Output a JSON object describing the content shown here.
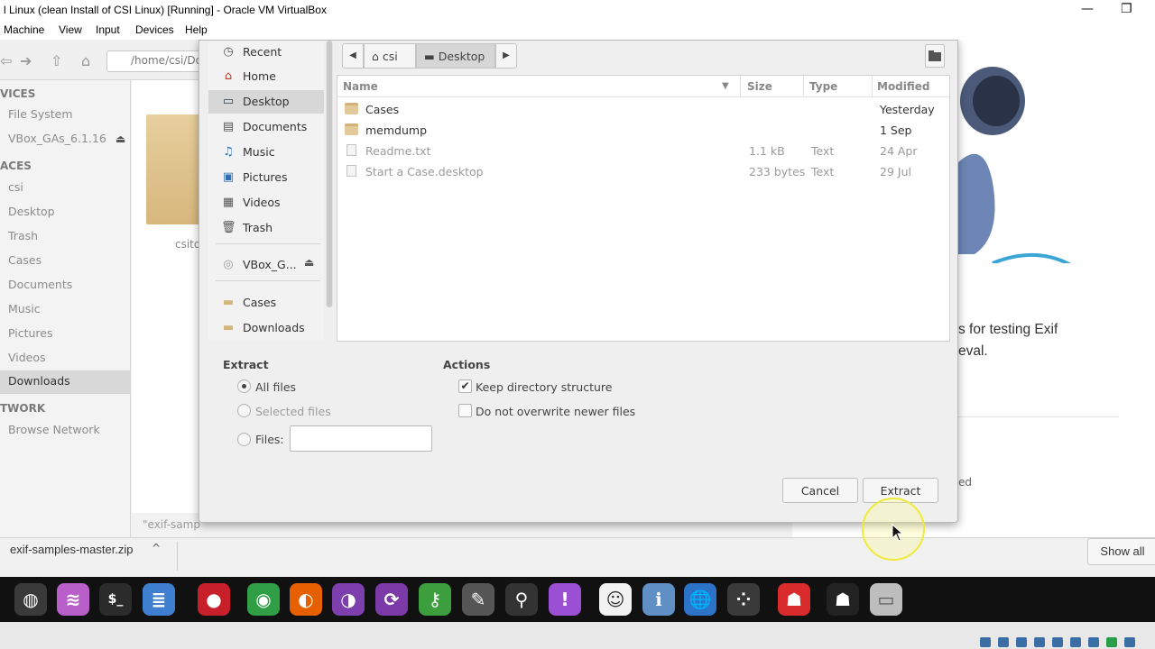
{
  "host": {
    "title": "l Linux (clean Install of CSI Linux) [Running] - Oracle VM VirtualBox",
    "menu": [
      "Machine",
      "View",
      "Input",
      "Devices",
      "Help"
    ],
    "window_controls": {
      "minimize": "—",
      "restore": "❐"
    }
  },
  "file_manager": {
    "path": "/home/csi/Do",
    "sidebar": {
      "devices_heading": "VICES",
      "devices": [
        "File System",
        "VBox_GAs_6.1.16"
      ],
      "places_heading": "ACES",
      "places": [
        "csi",
        "Desktop",
        "Trash",
        "Cases",
        "Documents",
        "Music",
        "Pictures",
        "Videos",
        "Downloads"
      ],
      "selected": "Downloads",
      "network_heading": "TWORK",
      "network": [
        "Browse Network"
      ]
    },
    "item_label": "csito",
    "status": "\"exif-samp"
  },
  "browser_bg": {
    "text_line1": "s for testing Exif",
    "text_line2": "eval.",
    "ed": "ed"
  },
  "downloads_bar": {
    "file": "exif-samples-master.zip",
    "chevron": "^",
    "show_all": "Show all"
  },
  "dialog": {
    "places": [
      {
        "label": "Recent",
        "icon": "clock-icon",
        "glyph": "◷"
      },
      {
        "label": "Home",
        "icon": "home-icon",
        "glyph": "⌂"
      },
      {
        "label": "Desktop",
        "icon": "desktop-icon",
        "glyph": "▭"
      },
      {
        "label": "Documents",
        "icon": "documents-icon",
        "glyph": "▤"
      },
      {
        "label": "Music",
        "icon": "music-icon",
        "glyph": "♫"
      },
      {
        "label": "Pictures",
        "icon": "pictures-icon",
        "glyph": "▣"
      },
      {
        "label": "Videos",
        "icon": "videos-icon",
        "glyph": "▦"
      },
      {
        "label": "Trash",
        "icon": "trash-icon",
        "glyph": "🗑"
      },
      {
        "label": "VBox_G...",
        "icon": "disc-icon",
        "glyph": "◎"
      },
      {
        "label": "Cases",
        "icon": "folder-icon",
        "glyph": "▬"
      },
      {
        "label": "Downloads",
        "icon": "folder-icon",
        "glyph": "▬"
      }
    ],
    "selected_place": "Desktop",
    "pathbar": {
      "back": "◀",
      "home_label": "csi",
      "current": "Desktop",
      "forward": "▶"
    },
    "columns": {
      "name": "Name",
      "size": "Size",
      "type": "Type",
      "modified": "Modified"
    },
    "files": [
      {
        "name": "Cases",
        "kind": "folder",
        "size": "",
        "type": "",
        "modified": "Yesterday"
      },
      {
        "name": "memdump",
        "kind": "folder",
        "size": "",
        "type": "",
        "modified": "1 Sep"
      },
      {
        "name": "Readme.txt",
        "kind": "file",
        "size": "1.1 kB",
        "type": "Text",
        "modified": "24 Apr"
      },
      {
        "name": "Start a Case.desktop",
        "kind": "file",
        "size": "233 bytes",
        "type": "Text",
        "modified": "29 Jul"
      }
    ],
    "extract": {
      "heading": "Extract",
      "all_files": "All files",
      "selected_files": "Selected files",
      "files": "Files:",
      "files_value": "",
      "selected_option": "All files"
    },
    "actions": {
      "heading": "Actions",
      "keep_structure": "Keep directory structure",
      "keep_structure_checked": true,
      "no_overwrite": "Do not overwrite newer files",
      "no_overwrite_checked": false
    },
    "buttons": {
      "cancel": "Cancel",
      "extract": "Extract"
    }
  },
  "taskbar": {
    "apps": [
      {
        "icon": "globe-wire-icon",
        "glyph": "◍",
        "color": "#3a3a3a"
      },
      {
        "icon": "waveform-icon",
        "glyph": "≋",
        "color": "#b85fc9"
      },
      {
        "icon": "terminal-icon",
        "glyph": "$_",
        "color": "#2b2b2b"
      },
      {
        "icon": "text-editor-icon",
        "glyph": "≣",
        "color": "#3f7fd0"
      },
      {
        "icon": "cherry-icon",
        "glyph": "●",
        "color": "#c8202a"
      },
      {
        "icon": "chrome-icon",
        "glyph": "◉",
        "color": "#2f9e44"
      },
      {
        "icon": "firefox-icon",
        "glyph": "◐",
        "color": "#e66000"
      },
      {
        "icon": "tor-icon",
        "glyph": "◑",
        "color": "#7d3fae"
      },
      {
        "icon": "sync-icon",
        "glyph": "⟳",
        "color": "#7c3aa8"
      },
      {
        "icon": "keyhole-icon",
        "glyph": "⚷",
        "color": "#3d9e3d"
      },
      {
        "icon": "pen-icon",
        "glyph": "✎",
        "color": "#565656"
      },
      {
        "icon": "person-icon",
        "glyph": "⚲",
        "color": "#333333"
      },
      {
        "icon": "alert-bubble-icon",
        "glyph": "!",
        "color": "#9b4fd4"
      },
      {
        "icon": "agent-icon",
        "glyph": "☺",
        "color": "#f2f2f2"
      },
      {
        "icon": "user-info-icon",
        "glyph": "ℹ",
        "color": "#5f8fc4"
      },
      {
        "icon": "earth-icon",
        "glyph": "🌐",
        "color": "#2c72c7"
      },
      {
        "icon": "circles-icon",
        "glyph": "⁘",
        "color": "#3a3a3a"
      },
      {
        "icon": "dog-red-icon",
        "glyph": "☗",
        "color": "#d92b2b"
      },
      {
        "icon": "doberman-icon",
        "glyph": "☗",
        "color": "#222222"
      },
      {
        "icon": "drive-icon",
        "glyph": "▭",
        "color": "#bdbdbd"
      }
    ]
  }
}
